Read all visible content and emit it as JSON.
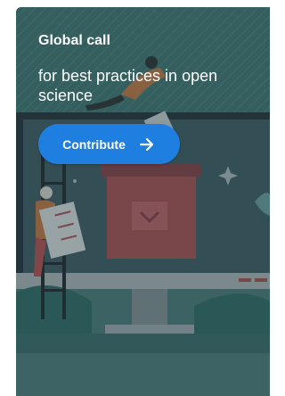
{
  "card": {
    "title": "Global call",
    "subtitle": "for best practices in open science",
    "cta_label": "Contribute",
    "cta_icon": "arrow-right-icon"
  },
  "colors": {
    "cta_background": "#1f7fe0",
    "text": "#ffffff",
    "backdrop": "#2f5f5b"
  }
}
